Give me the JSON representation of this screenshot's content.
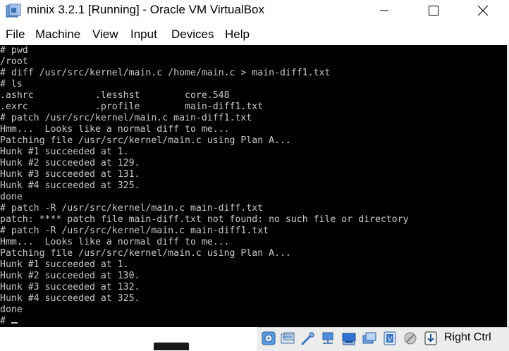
{
  "window": {
    "title": "minix 3.2.1 [Running] - Oracle VM VirtualBox"
  },
  "menu": [
    "File",
    "Machine",
    "View",
    "Input",
    "Devices",
    "Help"
  ],
  "terminal": {
    "lines": [
      "# pwd",
      "/root",
      "# diff /usr/src/kernel/main.c /home/main.c > main-diff1.txt",
      "# ls",
      ".ashrc           .lesshst        core.548",
      ".exrc            .profile        main-diff1.txt",
      "# patch /usr/src/kernel/main.c main-diff1.txt",
      "Hmm...  Looks like a normal diff to me...",
      "Patching file /usr/src/kernel/main.c using Plan A...",
      "Hunk #1 succeeded at 1.",
      "Hunk #2 succeeded at 129.",
      "Hunk #3 succeeded at 131.",
      "Hunk #4 succeeded at 325.",
      "done",
      "# patch -R /usr/src/kernel/main.c main-diff.txt",
      "patch: **** patch file main-diff.txt not found: no such file or directory",
      "# patch -R /usr/src/kernel/main.c main-diff1.txt",
      "Hmm...  Looks like a normal diff to me...",
      "Patching file /usr/src/kernel/main.c using Plan A...",
      "Hunk #1 succeeded at 1.",
      "Hunk #2 succeeded at 130.",
      "Hunk #3 succeeded at 132.",
      "Hunk #4 succeeded at 325.",
      "done"
    ],
    "prompt": "# "
  },
  "statusbar": {
    "host_key": "Right Ctrl",
    "icons": [
      "hard-disk-icon",
      "optical-drive-icon",
      "audio-icon",
      "network-icon",
      "usb-icon",
      "shared-folders-icon",
      "display-icon",
      "video-capture-icon",
      "mouse-integration-icon",
      "keyboard-capture-icon"
    ]
  },
  "colors": {
    "terminal_bg": "#000000",
    "terminal_fg": "#c8c8c8",
    "statusbar_bg": "#ececec"
  }
}
